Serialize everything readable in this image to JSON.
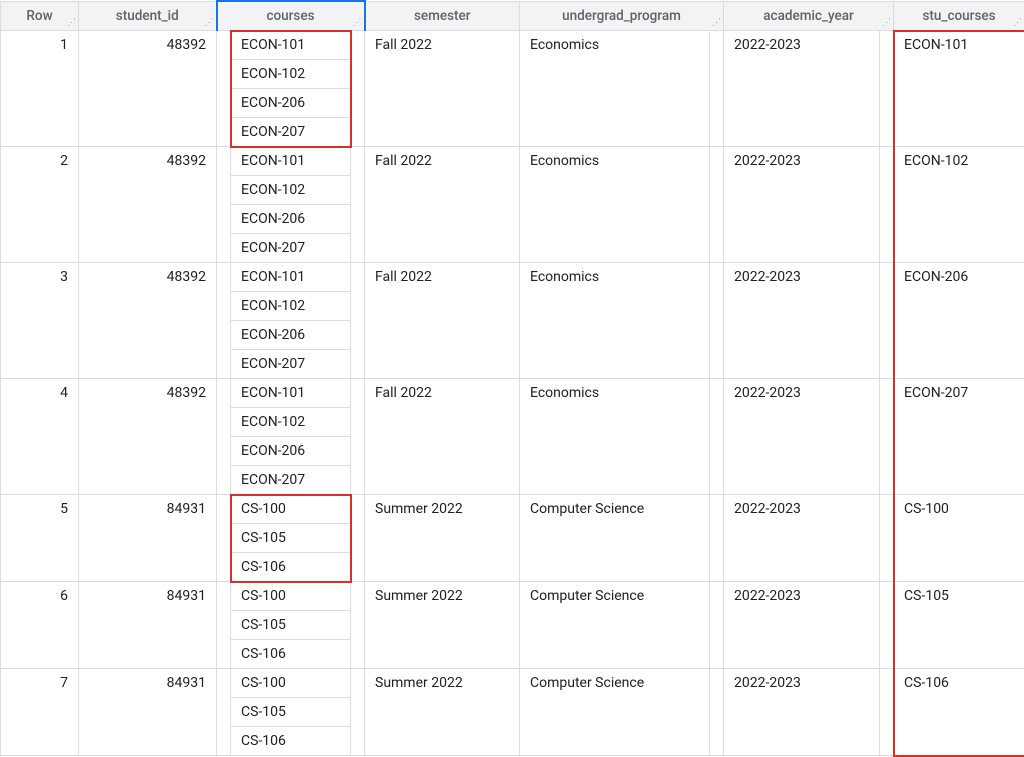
{
  "columns": {
    "row": "Row",
    "student_id": "student_id",
    "courses": "courses",
    "semester": "semester",
    "undergrad_program": "undergrad_program",
    "academic_year": "academic_year",
    "stu_courses": "stu_courses"
  },
  "rows": [
    {
      "n": "1",
      "student_id": "48392",
      "courses": [
        "ECON-101",
        "ECON-102",
        "ECON-206",
        "ECON-207"
      ],
      "semester": "Fall 2022",
      "undergrad_program": "Economics",
      "academic_year": "2022-2023",
      "stu_courses": "ECON-101",
      "highlight_courses": true
    },
    {
      "n": "2",
      "student_id": "48392",
      "courses": [
        "ECON-101",
        "ECON-102",
        "ECON-206",
        "ECON-207"
      ],
      "semester": "Fall 2022",
      "undergrad_program": "Economics",
      "academic_year": "2022-2023",
      "stu_courses": "ECON-102",
      "highlight_courses": false
    },
    {
      "n": "3",
      "student_id": "48392",
      "courses": [
        "ECON-101",
        "ECON-102",
        "ECON-206",
        "ECON-207"
      ],
      "semester": "Fall 2022",
      "undergrad_program": "Economics",
      "academic_year": "2022-2023",
      "stu_courses": "ECON-206",
      "highlight_courses": false
    },
    {
      "n": "4",
      "student_id": "48392",
      "courses": [
        "ECON-101",
        "ECON-102",
        "ECON-206",
        "ECON-207"
      ],
      "semester": "Fall 2022",
      "undergrad_program": "Economics",
      "academic_year": "2022-2023",
      "stu_courses": "ECON-207",
      "highlight_courses": false
    },
    {
      "n": "5",
      "student_id": "84931",
      "courses": [
        "CS-100",
        "CS-105",
        "CS-106"
      ],
      "semester": "Summer 2022",
      "undergrad_program": "Computer Science",
      "academic_year": "2022-2023",
      "stu_courses": "CS-100",
      "highlight_courses": true
    },
    {
      "n": "6",
      "student_id": "84931",
      "courses": [
        "CS-100",
        "CS-105",
        "CS-106"
      ],
      "semester": "Summer 2022",
      "undergrad_program": "Computer Science",
      "academic_year": "2022-2023",
      "stu_courses": "CS-105",
      "highlight_courses": false
    },
    {
      "n": "7",
      "student_id": "84931",
      "courses": [
        "CS-100",
        "CS-105",
        "CS-106"
      ],
      "semester": "Summer 2022",
      "undergrad_program": "Computer Science",
      "academic_year": "2022-2023",
      "stu_courses": "CS-106",
      "highlight_courses": false
    }
  ],
  "highlight_stu_courses_column": true
}
